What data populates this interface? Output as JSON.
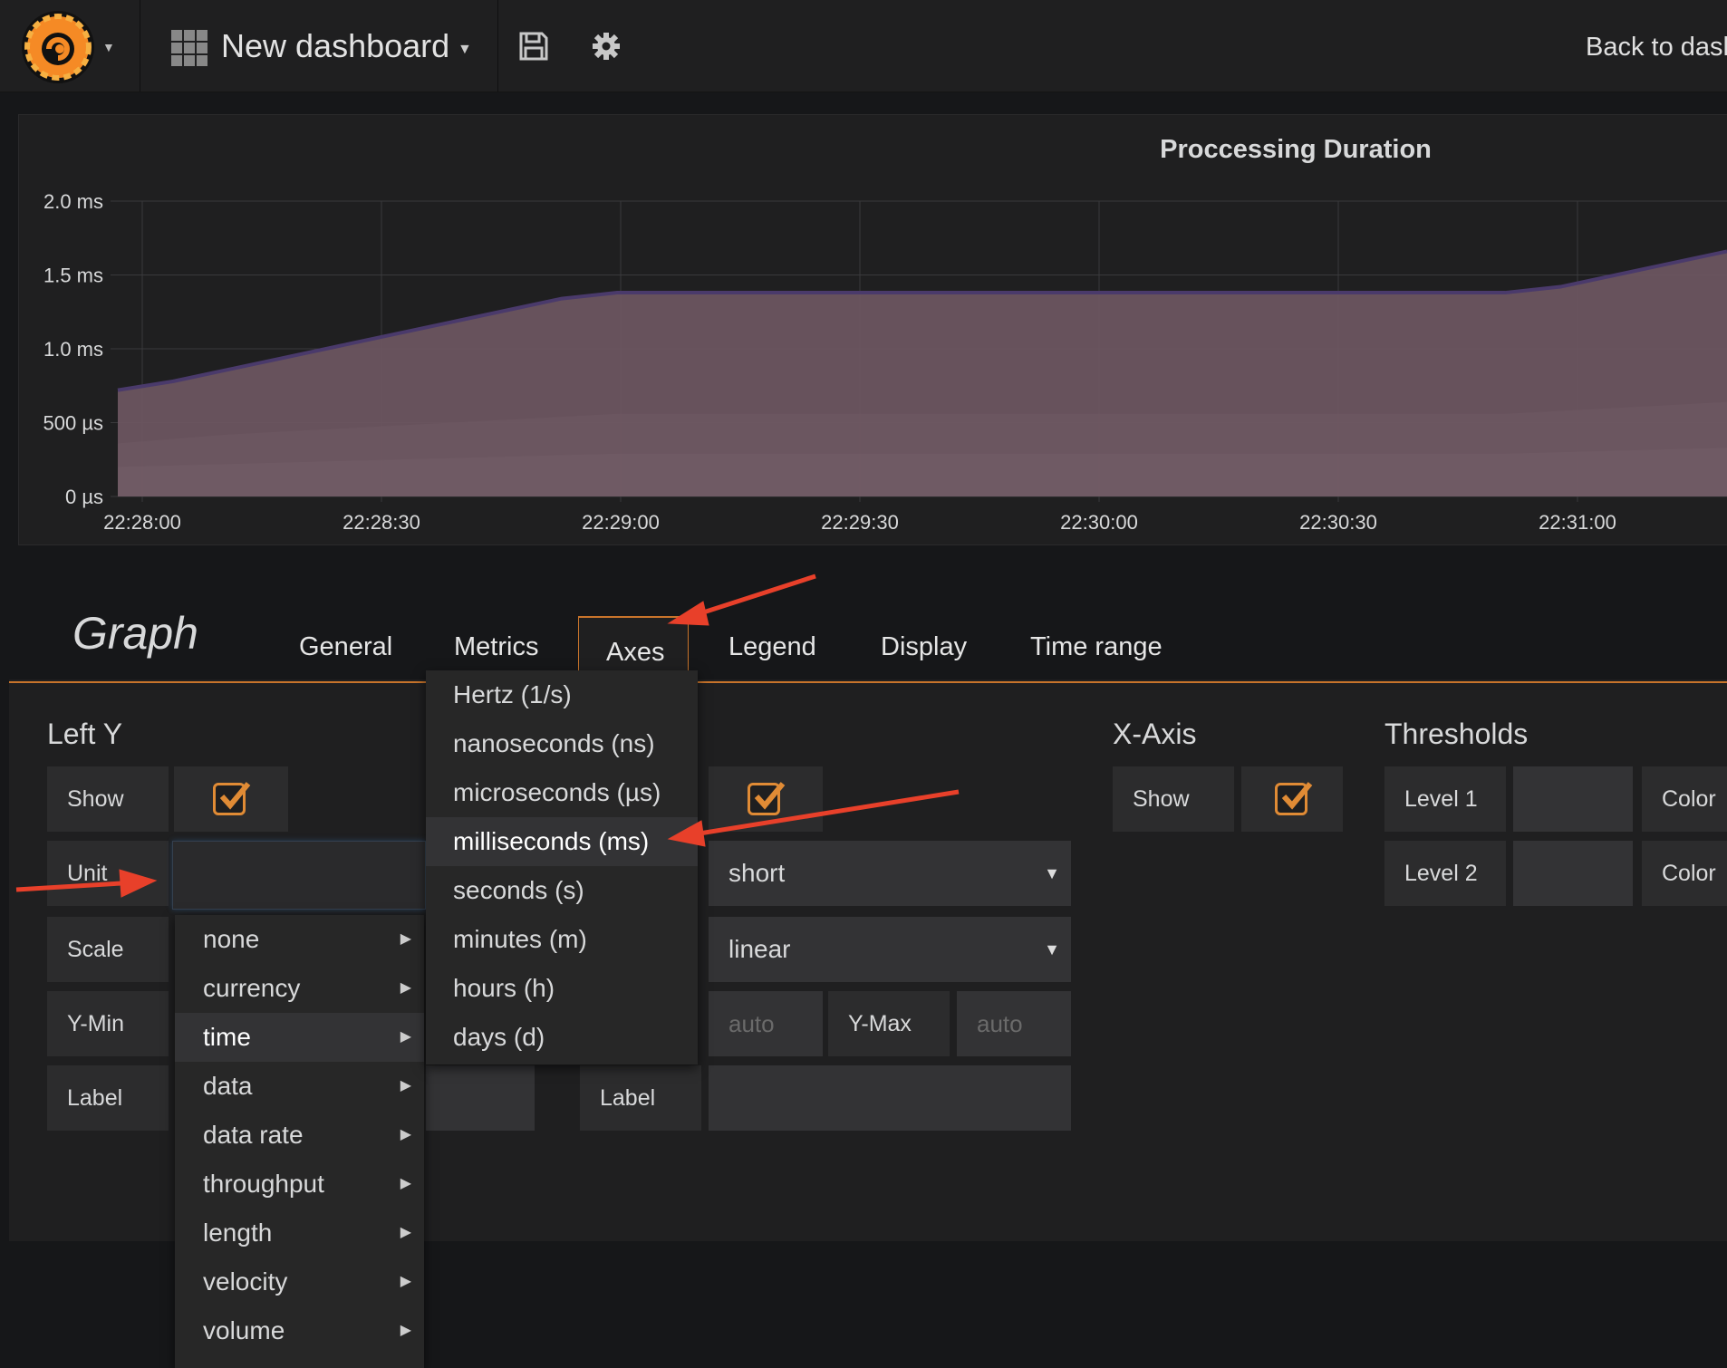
{
  "navbar": {
    "dashboard_title": "New dashboard",
    "back_link": "Back to dashboard"
  },
  "chart_data": {
    "type": "area",
    "title": "Proccessing Duration",
    "x": [
      "22:28:00",
      "22:28:30",
      "22:29:00",
      "22:29:30",
      "22:30:00",
      "22:30:30",
      "22:31:00"
    ],
    "y_ticks": [
      "2.0 ms",
      "1.5 ms",
      "1.0 ms",
      "500 µs",
      "0 µs"
    ],
    "ylim": [
      0,
      2.0
    ],
    "y_unit": "ms",
    "grid": true,
    "series": [
      {
        "values": [
          0.72,
          0.78,
          0.86,
          0.94,
          1.02,
          1.1,
          1.18,
          1.26,
          1.34,
          1.38,
          1.38,
          1.38,
          1.38,
          1.38,
          1.38,
          1.38,
          1.38,
          1.38,
          1.38,
          1.38,
          1.38,
          1.38,
          1.38,
          1.38,
          1.38,
          1.38,
          1.42,
          1.5,
          1.58,
          1.66
        ],
        "color": "#6b5560"
      },
      {
        "values": [
          0.36,
          0.39,
          0.42,
          0.44,
          0.46,
          0.48,
          0.5,
          0.52,
          0.54,
          0.56,
          0.56,
          0.56,
          0.56,
          0.56,
          0.56,
          0.56,
          0.56,
          0.56,
          0.56,
          0.56,
          0.56,
          0.56,
          0.56,
          0.56,
          0.56,
          0.56,
          0.58,
          0.6,
          0.62,
          0.64
        ],
        "color": "#6f5a63"
      },
      {
        "values": [
          0.2,
          0.21,
          0.22,
          0.23,
          0.24,
          0.25,
          0.26,
          0.27,
          0.28,
          0.29,
          0.29,
          0.29,
          0.29,
          0.29,
          0.29,
          0.29,
          0.29,
          0.29,
          0.29,
          0.29,
          0.29,
          0.29,
          0.29,
          0.29,
          0.29,
          0.29,
          0.3,
          0.31,
          0.32,
          0.33
        ],
        "color": "#735e67"
      }
    ]
  },
  "editor": {
    "title": "Graph",
    "tabs": [
      "General",
      "Metrics",
      "Axes",
      "Legend",
      "Display",
      "Time range"
    ],
    "active_tab": "Axes",
    "left_y": {
      "title": "Left Y",
      "show_label": "Show",
      "show_checked": true,
      "unit_label": "Unit",
      "unit_value": "",
      "scale_label": "Scale",
      "ymin_label": "Y-Min",
      "label_label": "Label"
    },
    "right_y": {
      "show_checked": true,
      "unit_value": "short",
      "scale_value": "linear",
      "ymin_placeholder": "auto",
      "ymax_label": "Y-Max",
      "ymax_placeholder": "auto",
      "label_label": "Label"
    },
    "x_axis": {
      "title": "X-Axis",
      "show_label": "Show",
      "show_checked": true
    },
    "thresholds": {
      "title": "Thresholds",
      "level1_label": "Level 1",
      "level2_label": "Level 2",
      "color_label": "Color"
    }
  },
  "unit_menu": {
    "categories": [
      "none",
      "currency",
      "time",
      "data",
      "data rate",
      "throughput",
      "length",
      "velocity",
      "volume"
    ],
    "active_category": "time",
    "time_units": [
      "Hertz (1/s)",
      "nanoseconds (ns)",
      "microseconds (µs)",
      "milliseconds (ms)",
      "seconds (s)",
      "minutes (m)",
      "hours (h)",
      "days (d)"
    ],
    "highlighted_unit": "milliseconds (ms)"
  },
  "colors": {
    "accent": "#c8742b",
    "checkbox": "#e08b35",
    "annotation_arrow": "#e8402a",
    "series_line": "#4a3a6b"
  }
}
